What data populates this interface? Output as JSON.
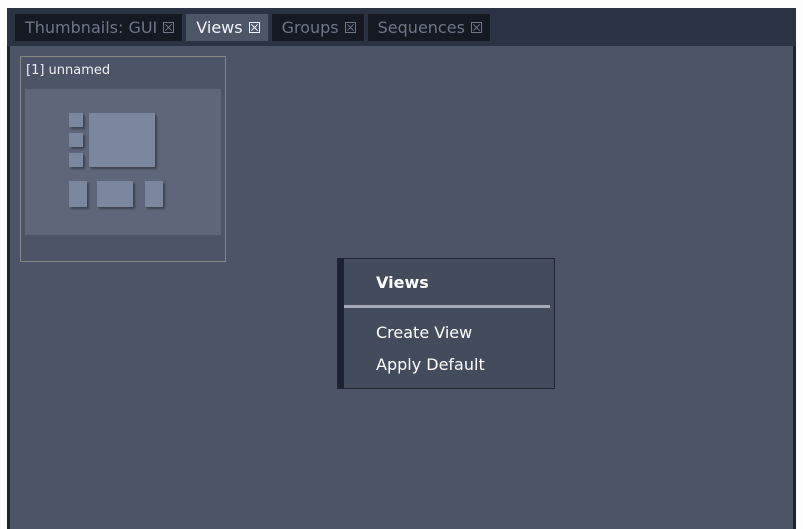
{
  "tabs": [
    {
      "label": "Thumbnails: GUI",
      "active": false
    },
    {
      "label": "Views",
      "active": true
    },
    {
      "label": "Groups",
      "active": false
    },
    {
      "label": "Sequences",
      "active": false
    }
  ],
  "thumbnail": {
    "label": "[1] unnamed"
  },
  "context_menu": {
    "title": "Views",
    "items": [
      "Create View",
      "Apply Default"
    ]
  },
  "colors": {
    "panel_bg": "#4b5567",
    "tab_active": "#4d5667",
    "tab_inactive": "#151a22",
    "menu_bg": "#434c5d"
  }
}
